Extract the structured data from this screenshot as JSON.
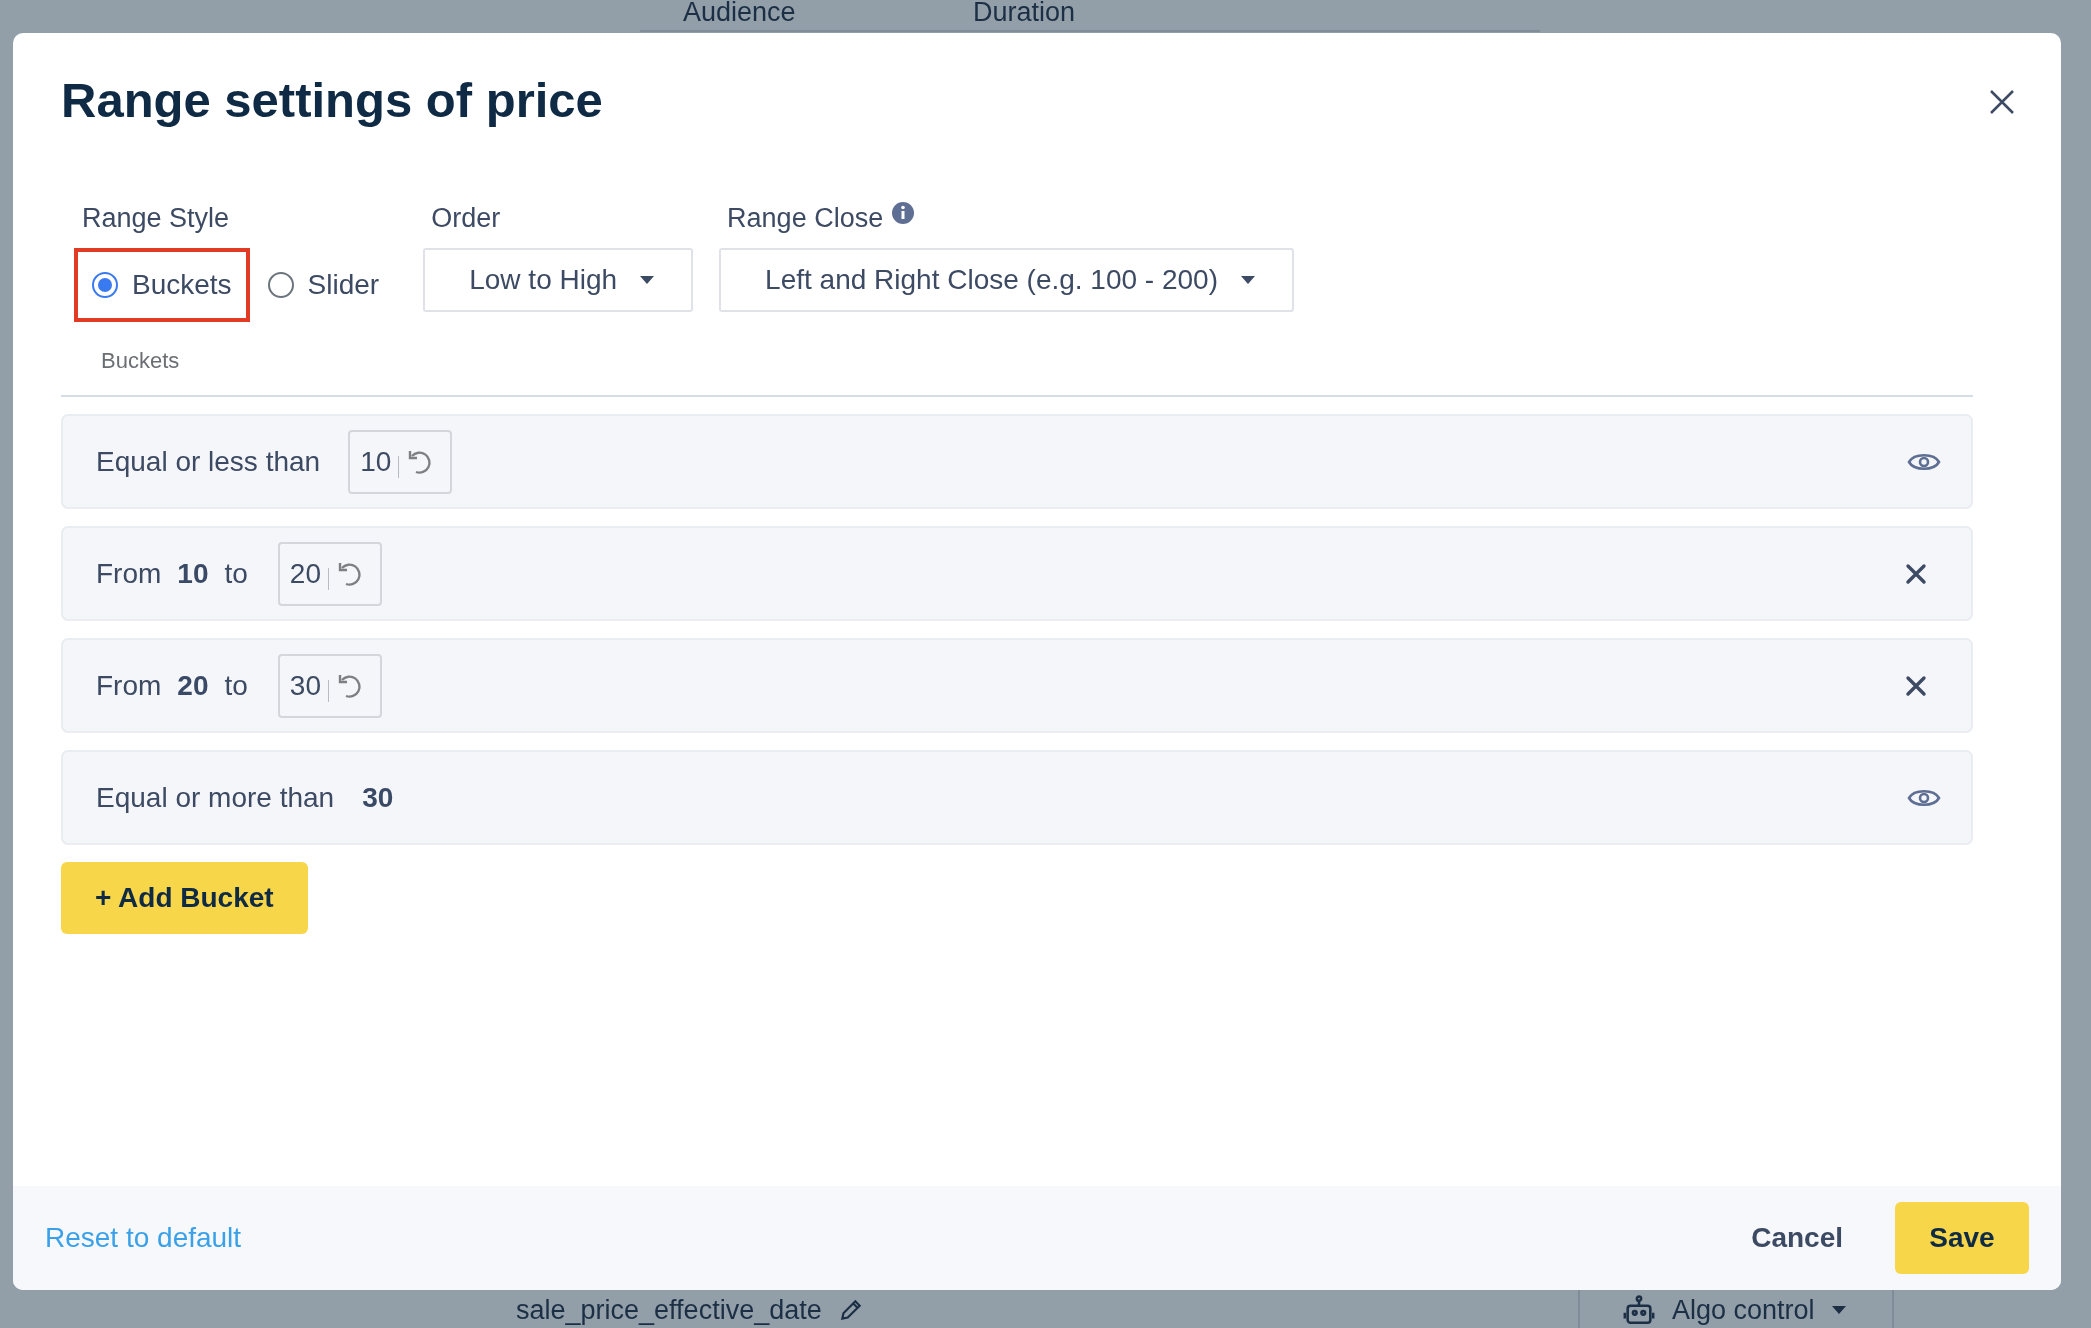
{
  "background": {
    "columns": [
      "Audience",
      "Duration"
    ],
    "field": "sale_price_effective_date",
    "control": "Algo control"
  },
  "dialog": {
    "title": "Range settings of price",
    "range_style": {
      "label": "Range Style",
      "options": [
        {
          "label": "Buckets",
          "selected": true,
          "highlighted": true
        },
        {
          "label": "Slider",
          "selected": false,
          "highlighted": false
        }
      ]
    },
    "order": {
      "label": "Order",
      "value": "Low to High"
    },
    "range_close": {
      "label": "Range Close",
      "value": "Left and Right Close (e.g. 100 - 200)"
    },
    "section_label": "Buckets",
    "buckets": [
      {
        "kind": "min",
        "text": "Equal or less than",
        "value": "10"
      },
      {
        "kind": "range",
        "from_label": "From",
        "from": "10",
        "to_label": "to",
        "value": "20"
      },
      {
        "kind": "range",
        "from_label": "From",
        "from": "20",
        "to_label": "to",
        "value": "30"
      },
      {
        "kind": "max",
        "text": "Equal or more than",
        "value": "30"
      }
    ],
    "add_button": "+ Add Bucket",
    "footer": {
      "reset": "Reset to default",
      "cancel": "Cancel",
      "save": "Save"
    }
  }
}
